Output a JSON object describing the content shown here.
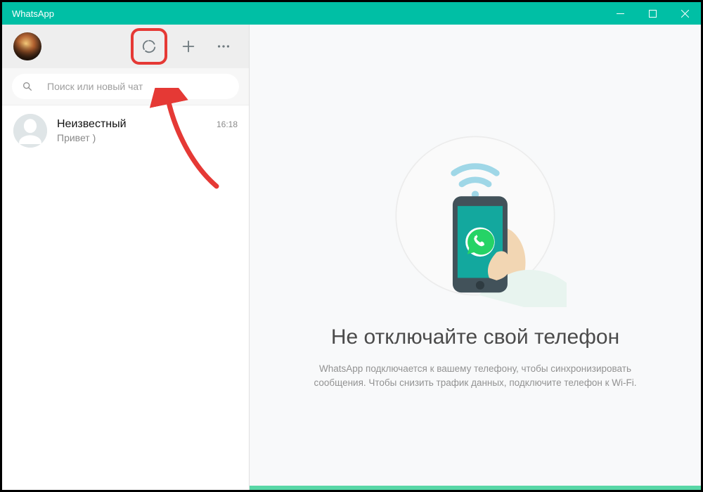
{
  "window": {
    "title": "WhatsApp"
  },
  "search": {
    "placeholder": "Поиск или новый чат"
  },
  "chats": [
    {
      "name": "Неизвестный",
      "preview": "Привет )",
      "time": "16:18"
    }
  ],
  "empty_state": {
    "heading": "Не отключайте свой телефон",
    "body": "WhatsApp подключается к вашему телефону, чтобы синхронизировать сообщения. Чтобы снизить трафик данных, подключите телефон к Wi-Fi."
  },
  "icons": {
    "status": "status-icon",
    "new_chat": "plus-icon",
    "menu": "dots-icon",
    "search": "search-icon"
  },
  "colors": {
    "brand": "#00BFA5",
    "highlight": "#E53935"
  }
}
